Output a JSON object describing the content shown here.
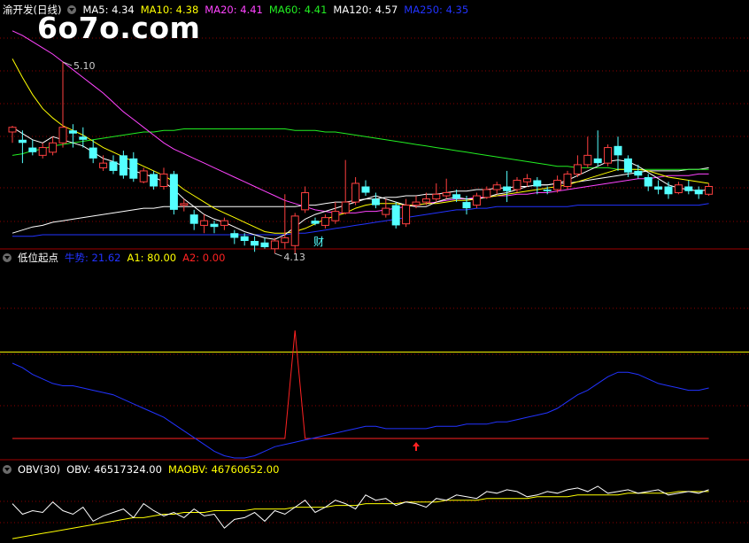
{
  "watermark": "6o7o.com",
  "main_panel": {
    "stock_name": "渝开发(日线)",
    "ma_labels": [
      {
        "text": "MA5: 4.34",
        "color": "#ffffff"
      },
      {
        "text": "MA10: 4.38",
        "color": "#ffff00"
      },
      {
        "text": "MA20: 4.41",
        "color": "#ff44ff"
      },
      {
        "text": "MA60: 4.41",
        "color": "#22ee22"
      },
      {
        "text": "MA120: 4.57",
        "color": "#ffffff"
      },
      {
        "text": "MA250: 4.35",
        "color": "#2233ff"
      }
    ],
    "high_marker": "5.10",
    "low_marker": "4.13",
    "badge": "财"
  },
  "indicator_panel": {
    "title": "低位起点",
    "labels": [
      {
        "text": "牛势: 21.62",
        "color": "#2233ff"
      },
      {
        "text": "A1: 80.00",
        "color": "#ffff00"
      },
      {
        "text": "A2: 0.00",
        "color": "#ff2222"
      }
    ]
  },
  "obv_panel": {
    "title": "OBV(30)",
    "labels": [
      {
        "text": "OBV: 46517324.00",
        "color": "#ffffff"
      },
      {
        "text": "MAOBV: 46760652.00",
        "color": "#ffff00"
      }
    ]
  },
  "chart_data": {
    "type": "line",
    "colors": {
      "up": "#ff4040",
      "down": "#54ffff",
      "ma5": "#ffffff",
      "ma10": "#ffff00",
      "ma20": "#ff44ff",
      "ma60": "#22ee22",
      "ma120": "#ffffff",
      "ma250": "#2233ff",
      "trend": "#2233ff",
      "signal": "#ff2222",
      "a1": "#ffff00",
      "obv": "#ffffff",
      "maobv": "#ffff00"
    },
    "price_range": [
      3.95,
      5.35
    ],
    "candles": [
      [
        4.65,
        4.68,
        4.58,
        4.69
      ],
      [
        4.6,
        4.58,
        4.45,
        4.66
      ],
      [
        4.55,
        4.52,
        4.5,
        4.6
      ],
      [
        4.5,
        4.55,
        4.48,
        4.58
      ],
      [
        4.52,
        4.58,
        4.5,
        4.62
      ],
      [
        4.58,
        4.68,
        4.55,
        5.1
      ],
      [
        4.66,
        4.64,
        4.55,
        4.7
      ],
      [
        4.62,
        4.6,
        4.55,
        4.68
      ],
      [
        4.55,
        4.48,
        4.45,
        4.6
      ],
      [
        4.42,
        4.45,
        4.4,
        4.5
      ],
      [
        4.46,
        4.4,
        4.38,
        4.5
      ],
      [
        4.5,
        4.37,
        4.35,
        4.53
      ],
      [
        4.48,
        4.35,
        4.33,
        4.52
      ],
      [
        4.33,
        4.4,
        4.32,
        4.42
      ],
      [
        4.38,
        4.3,
        4.28,
        4.4
      ],
      [
        4.3,
        4.38,
        4.28,
        4.42
      ],
      [
        4.38,
        4.15,
        4.12,
        4.4
      ],
      [
        4.18,
        4.19,
        4.14,
        4.22
      ],
      [
        4.12,
        4.06,
        4.02,
        4.15
      ],
      [
        4.05,
        4.08,
        4.0,
        4.12
      ],
      [
        4.06,
        4.04,
        4.0,
        4.08
      ],
      [
        4.05,
        4.08,
        4.02,
        4.1
      ],
      [
        4.0,
        3.97,
        3.93,
        4.02
      ],
      [
        3.98,
        3.95,
        3.92,
        4.0
      ],
      [
        3.95,
        3.92,
        3.88,
        3.98
      ],
      [
        3.94,
        3.91,
        3.9,
        3.97
      ],
      [
        3.9,
        3.95,
        3.87,
        3.97
      ],
      [
        3.94,
        3.97,
        3.9,
        4.25
      ],
      [
        3.92,
        4.11,
        3.87,
        4.13
      ],
      [
        4.15,
        4.26,
        4.13,
        4.3
      ],
      [
        4.08,
        4.06,
        4.05,
        4.1
      ],
      [
        4.05,
        4.1,
        4.03,
        4.12
      ],
      [
        4.08,
        4.14,
        4.06,
        4.2
      ],
      [
        4.13,
        4.2,
        4.12,
        4.47
      ],
      [
        4.2,
        4.32,
        4.18,
        4.36
      ],
      [
        4.3,
        4.26,
        4.24,
        4.34
      ],
      [
        4.22,
        4.18,
        4.16,
        4.26
      ],
      [
        4.12,
        4.16,
        4.1,
        4.22
      ],
      [
        4.18,
        4.05,
        4.03,
        4.2
      ],
      [
        4.06,
        4.18,
        4.04,
        4.22
      ],
      [
        4.18,
        4.2,
        4.16,
        4.24
      ],
      [
        4.2,
        4.22,
        4.18,
        4.26
      ],
      [
        4.22,
        4.25,
        4.2,
        4.32
      ],
      [
        4.24,
        4.26,
        4.22,
        4.35
      ],
      [
        4.25,
        4.22,
        4.2,
        4.28
      ],
      [
        4.2,
        4.16,
        4.12,
        4.24
      ],
      [
        4.18,
        4.24,
        4.16,
        4.26
      ],
      [
        4.23,
        4.28,
        4.22,
        4.3
      ],
      [
        4.28,
        4.31,
        4.25,
        4.33
      ],
      [
        4.3,
        4.27,
        4.2,
        4.4
      ],
      [
        4.28,
        4.34,
        4.26,
        4.36
      ],
      [
        4.33,
        4.35,
        4.3,
        4.38
      ],
      [
        4.34,
        4.3,
        4.25,
        4.36
      ],
      [
        4.28,
        4.27,
        4.25,
        4.3
      ],
      [
        4.28,
        4.34,
        4.26,
        4.37
      ],
      [
        4.3,
        4.38,
        4.28,
        4.4
      ],
      [
        4.38,
        4.44,
        4.36,
        4.5
      ],
      [
        4.44,
        4.5,
        4.42,
        4.62
      ],
      [
        4.48,
        4.45,
        4.43,
        4.66
      ],
      [
        4.45,
        4.55,
        4.43,
        4.57
      ],
      [
        4.56,
        4.5,
        4.4,
        4.62
      ],
      [
        4.48,
        4.39,
        4.36,
        4.5
      ],
      [
        4.4,
        4.37,
        4.35,
        4.44
      ],
      [
        4.36,
        4.3,
        4.27,
        4.38
      ],
      [
        4.3,
        4.28,
        4.25,
        4.34
      ],
      [
        4.3,
        4.25,
        4.22,
        4.33
      ],
      [
        4.26,
        4.31,
        4.25,
        4.33
      ],
      [
        4.3,
        4.27,
        4.25,
        4.34
      ],
      [
        4.28,
        4.25,
        4.22,
        4.3
      ],
      [
        4.25,
        4.3,
        4.24,
        4.32
      ]
    ],
    "ma5": [
      4.68,
      4.64,
      4.6,
      4.58,
      4.62,
      4.6,
      4.58,
      4.56,
      4.52,
      4.48,
      4.46,
      4.43,
      4.4,
      4.38,
      4.36,
      4.33,
      4.28,
      4.22,
      4.17,
      4.12,
      4.09,
      4.07,
      4.04,
      4.01,
      3.99,
      3.97,
      3.96,
      3.99,
      4.04,
      4.09,
      4.12,
      4.14,
      4.16,
      4.18,
      4.2,
      4.22,
      4.24,
      4.22,
      4.2,
      4.18,
      4.17,
      4.17,
      4.2,
      4.22,
      4.23,
      4.22,
      4.22,
      4.23,
      4.25,
      4.26,
      4.28,
      4.3,
      4.31,
      4.31,
      4.32,
      4.34,
      4.37,
      4.4,
      4.43,
      4.46,
      4.47,
      4.46,
      4.43,
      4.39,
      4.35,
      4.31,
      4.29,
      4.28,
      4.27,
      4.28
    ],
    "ma10": [
      5.12,
      5.0,
      4.89,
      4.8,
      4.74,
      4.69,
      4.66,
      4.63,
      4.59,
      4.55,
      4.52,
      4.49,
      4.46,
      4.43,
      4.4,
      4.37,
      4.33,
      4.28,
      4.24,
      4.2,
      4.16,
      4.13,
      4.1,
      4.07,
      4.04,
      4.01,
      4.0,
      4.0,
      4.01,
      4.03,
      4.06,
      4.09,
      4.11,
      4.13,
      4.16,
      4.18,
      4.19,
      4.19,
      4.19,
      4.18,
      4.18,
      4.19,
      4.19,
      4.2,
      4.21,
      4.21,
      4.22,
      4.23,
      4.24,
      4.25,
      4.26,
      4.27,
      4.28,
      4.29,
      4.3,
      4.31,
      4.33,
      4.35,
      4.37,
      4.39,
      4.41,
      4.41,
      4.41,
      4.4,
      4.38,
      4.36,
      4.35,
      4.34,
      4.33,
      4.32
    ],
    "ma20": [
      5.3,
      5.27,
      5.23,
      5.19,
      5.15,
      5.1,
      5.05,
      5.0,
      4.95,
      4.9,
      4.84,
      4.78,
      4.73,
      4.68,
      4.63,
      4.58,
      4.54,
      4.51,
      4.48,
      4.45,
      4.42,
      4.39,
      4.36,
      4.33,
      4.3,
      4.27,
      4.24,
      4.21,
      4.19,
      4.17,
      4.15,
      4.14,
      4.13,
      4.13,
      4.13,
      4.14,
      4.14,
      4.15,
      4.16,
      4.17,
      4.18,
      4.19,
      4.2,
      4.21,
      4.22,
      4.22,
      4.23,
      4.23,
      4.24,
      4.24,
      4.25,
      4.25,
      4.26,
      4.26,
      4.27,
      4.28,
      4.29,
      4.3,
      4.31,
      4.32,
      4.33,
      4.34,
      4.35,
      4.35,
      4.36,
      4.37,
      4.37,
      4.37,
      4.38,
      4.38
    ],
    "ma60": [
      4.5,
      4.51,
      4.53,
      4.54,
      4.56,
      4.57,
      4.58,
      4.59,
      4.6,
      4.61,
      4.62,
      4.63,
      4.64,
      4.65,
      4.65,
      4.66,
      4.66,
      4.67,
      4.67,
      4.67,
      4.67,
      4.67,
      4.67,
      4.67,
      4.67,
      4.67,
      4.67,
      4.67,
      4.66,
      4.66,
      4.66,
      4.65,
      4.65,
      4.64,
      4.63,
      4.62,
      4.61,
      4.6,
      4.59,
      4.58,
      4.57,
      4.56,
      4.55,
      4.54,
      4.53,
      4.52,
      4.51,
      4.5,
      4.49,
      4.48,
      4.47,
      4.46,
      4.45,
      4.44,
      4.43,
      4.43,
      4.42,
      4.42,
      4.42,
      4.42,
      4.41,
      4.41,
      4.41,
      4.41,
      4.41,
      4.41,
      4.41,
      4.41,
      4.41,
      4.41
    ],
    "ma120": [
      4.0,
      4.02,
      4.04,
      4.05,
      4.07,
      4.08,
      4.09,
      4.1,
      4.11,
      4.12,
      4.13,
      4.14,
      4.15,
      4.16,
      4.16,
      4.17,
      4.17,
      4.17,
      4.17,
      4.17,
      4.17,
      4.17,
      4.17,
      4.17,
      4.17,
      4.17,
      4.17,
      4.17,
      4.17,
      4.18,
      4.18,
      4.19,
      4.2,
      4.2,
      4.21,
      4.22,
      4.22,
      4.23,
      4.23,
      4.24,
      4.24,
      4.25,
      4.25,
      4.26,
      4.27,
      4.27,
      4.28,
      4.28,
      4.29,
      4.29,
      4.3,
      4.3,
      4.31,
      4.31,
      4.32,
      4.32,
      4.33,
      4.34,
      4.35,
      4.36,
      4.37,
      4.38,
      4.39,
      4.4,
      4.4,
      4.4,
      4.4,
      4.41,
      4.41,
      4.42
    ],
    "ma250": [
      3.98,
      3.98,
      3.98,
      3.99,
      3.99,
      3.99,
      3.99,
      3.99,
      3.99,
      3.99,
      3.99,
      3.99,
      3.99,
      3.99,
      3.99,
      3.99,
      3.99,
      3.99,
      3.99,
      3.99,
      3.99,
      3.99,
      3.99,
      3.99,
      3.99,
      3.99,
      3.99,
      3.99,
      4.0,
      4.0,
      4.01,
      4.02,
      4.03,
      4.04,
      4.05,
      4.06,
      4.07,
      4.08,
      4.09,
      4.1,
      4.11,
      4.12,
      4.13,
      4.14,
      4.15,
      4.15,
      4.16,
      4.16,
      4.17,
      4.17,
      4.17,
      4.17,
      4.17,
      4.17,
      4.17,
      4.17,
      4.18,
      4.18,
      4.18,
      4.18,
      4.18,
      4.18,
      4.18,
      4.18,
      4.18,
      4.18,
      4.18,
      4.18,
      4.18,
      4.19
    ],
    "indicator_range": [
      0,
      100
    ],
    "trend": [
      42,
      40,
      37,
      35,
      33,
      32,
      32,
      31,
      30,
      29,
      28,
      26,
      24,
      22,
      20,
      18,
      15,
      12,
      9,
      6,
      3,
      1,
      0,
      0,
      1,
      3,
      5,
      6,
      7,
      8,
      9,
      10,
      11,
      12,
      13,
      14,
      14,
      13,
      13,
      13,
      13,
      13,
      14,
      14,
      14,
      15,
      15,
      15,
      16,
      16,
      17,
      18,
      19,
      20,
      22,
      25,
      28,
      30,
      33,
      36,
      38,
      38,
      37,
      35,
      33,
      32,
      31,
      30,
      30,
      31
    ],
    "signal": [
      0,
      0,
      0,
      0,
      0,
      0,
      0,
      0,
      0,
      0,
      0,
      0,
      0,
      0,
      0,
      0,
      0,
      0,
      0,
      0,
      0,
      0,
      0,
      0,
      0,
      0,
      0,
      0,
      100,
      0,
      0,
      0,
      0,
      0,
      0,
      0,
      0,
      0,
      0,
      0,
      0,
      0,
      0,
      0,
      0,
      0,
      0,
      0,
      0,
      0,
      0,
      0,
      0,
      0,
      0,
      0,
      0,
      0,
      0,
      0,
      0,
      0,
      0,
      0,
      0,
      0,
      0,
      0,
      0,
      0
    ],
    "a1": 80,
    "obv": [
      50,
      44,
      46,
      45,
      51,
      46,
      44,
      48,
      40,
      43,
      45,
      47,
      42,
      50,
      46,
      43,
      45,
      42,
      47,
      43,
      44,
      36,
      41,
      42,
      45,
      40,
      46,
      44,
      48,
      52,
      45,
      48,
      52,
      50,
      47,
      55,
      52,
      53,
      49,
      51,
      50,
      48,
      53,
      52,
      55,
      54,
      53,
      57,
      56,
      58,
      57,
      54,
      55,
      57,
      56,
      58,
      59,
      57,
      60,
      56,
      57,
      58,
      56,
      57,
      58,
      55,
      56,
      57,
      56,
      58
    ],
    "maobv": [
      30,
      31,
      32,
      33,
      34,
      35,
      36,
      37,
      38,
      39,
      40,
      41,
      42,
      42,
      43,
      44,
      44,
      45,
      45,
      45,
      46,
      46,
      46,
      46,
      47,
      47,
      47,
      47,
      48,
      48,
      48,
      48,
      49,
      49,
      49,
      50,
      50,
      50,
      50,
      51,
      51,
      51,
      51,
      52,
      52,
      52,
      52,
      53,
      53,
      53,
      53,
      53,
      54,
      54,
      54,
      54,
      55,
      55,
      55,
      55,
      55,
      56,
      56,
      56,
      56,
      56,
      57,
      57,
      57,
      57
    ]
  }
}
